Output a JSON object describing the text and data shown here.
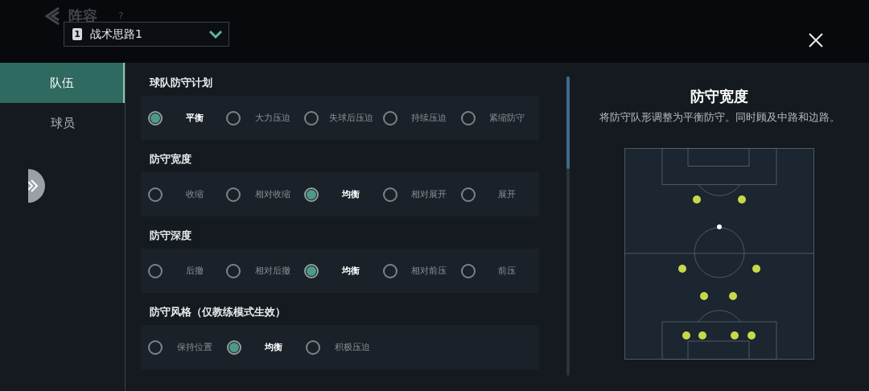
{
  "header": {
    "title": "阵容",
    "help": "?"
  },
  "tactic_dropdown": {
    "badge": "1",
    "value": "战术思路1"
  },
  "sidebar": {
    "items": [
      {
        "label": "队伍",
        "selected": true
      },
      {
        "label": "球员",
        "selected": false
      }
    ]
  },
  "sections": [
    {
      "title": "球队防守计划",
      "options": [
        {
          "label": "平衡",
          "selected": true
        },
        {
          "label": "大力压迫",
          "selected": false
        },
        {
          "label": "失球后压迫",
          "selected": false
        },
        {
          "label": "持续压迫",
          "selected": false
        },
        {
          "label": "紧缩防守",
          "selected": false
        }
      ]
    },
    {
      "title": "防守宽度",
      "options": [
        {
          "label": "收缩",
          "selected": false
        },
        {
          "label": "相对收缩",
          "selected": false
        },
        {
          "label": "均衡",
          "selected": true
        },
        {
          "label": "相对展开",
          "selected": false
        },
        {
          "label": "展开",
          "selected": false
        }
      ]
    },
    {
      "title": "防守深度",
      "options": [
        {
          "label": "后撤",
          "selected": false
        },
        {
          "label": "相对后撤",
          "selected": false
        },
        {
          "label": "均衡",
          "selected": true
        },
        {
          "label": "相对前压",
          "selected": false
        },
        {
          "label": "前压",
          "selected": false
        }
      ]
    },
    {
      "title": "防守风格（仅教练模式生效）",
      "options": [
        {
          "label": "保持位置",
          "selected": false
        },
        {
          "label": "均衡",
          "selected": true
        },
        {
          "label": "积极压迫",
          "selected": false
        }
      ]
    }
  ],
  "detail": {
    "title": "防守宽度",
    "description": "将防守队形调整为平衡防守。同时顾及中路和边路。"
  }
}
